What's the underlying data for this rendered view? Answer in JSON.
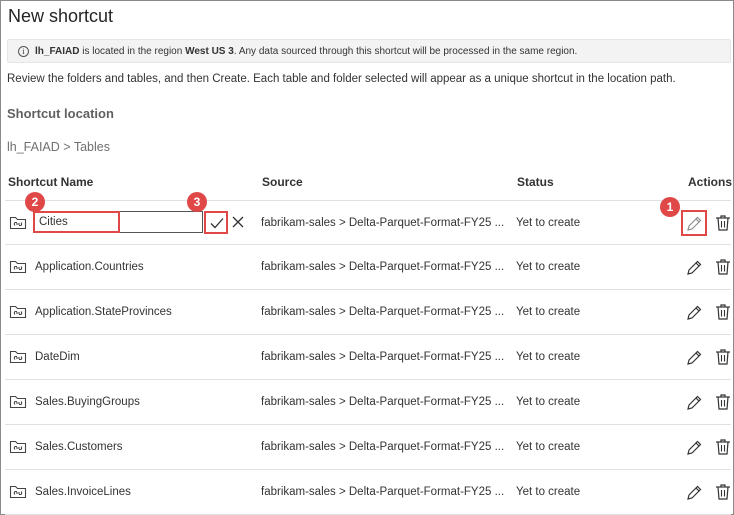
{
  "dialog": {
    "title": "New shortcut"
  },
  "banner": {
    "info_symbol": "i",
    "lakehouse": "lh_FAIAD",
    "text_mid": " is located in the region ",
    "region": "West US 3",
    "text_end": ". Any data sourced through this shortcut will be processed in the same region."
  },
  "description": "Review the folders and tables, and then Create. Each table and folder selected will appear as a unique shortcut in the location path.",
  "location": {
    "heading": "Shortcut location",
    "breadcrumb": "lh_FAIAD > Tables"
  },
  "table": {
    "headers": {
      "name": "Shortcut Name",
      "source": "Source",
      "status": "Status",
      "actions": "Actions"
    },
    "editing_value": "Cities",
    "rows": [
      {
        "name": "Cities",
        "source": "fabrikam-sales > Delta-Parquet-Format-FY25 ...",
        "status": "Yet to create"
      },
      {
        "name": "Application.Countries",
        "source": "fabrikam-sales > Delta-Parquet-Format-FY25 ...",
        "status": "Yet to create"
      },
      {
        "name": "Application.StateProvinces",
        "source": "fabrikam-sales > Delta-Parquet-Format-FY25 ...",
        "status": "Yet to create"
      },
      {
        "name": "DateDim",
        "source": "fabrikam-sales > Delta-Parquet-Format-FY25 ...",
        "status": "Yet to create"
      },
      {
        "name": "Sales.BuyingGroups",
        "source": "fabrikam-sales > Delta-Parquet-Format-FY25 ...",
        "status": "Yet to create"
      },
      {
        "name": "Sales.Customers",
        "source": "fabrikam-sales > Delta-Parquet-Format-FY25 ...",
        "status": "Yet to create"
      },
      {
        "name": "Sales.InvoiceLines",
        "source": "fabrikam-sales > Delta-Parquet-Format-FY25 ...",
        "status": "Yet to create"
      }
    ]
  },
  "callouts": [
    "1",
    "2",
    "3"
  ],
  "icons": {
    "folder": "shortcut-folder-icon",
    "edit": "pencil-icon",
    "delete": "trash-icon",
    "confirm": "checkmark-icon",
    "cancel": "close-icon"
  },
  "colors": {
    "highlight": "#e04848",
    "banner_bg": "#f3f3f3"
  }
}
